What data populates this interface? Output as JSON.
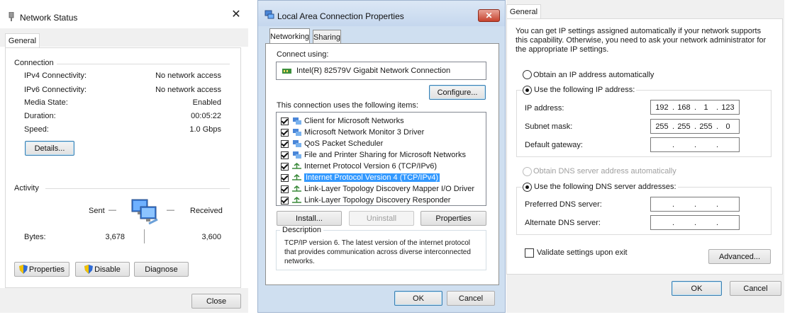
{
  "network_status": {
    "title": "Network Status",
    "close_glyph": "✕",
    "tab_general": "General",
    "connection_heading": "Connection",
    "rows": [
      {
        "label": "IPv4 Connectivity:",
        "value": "No network access"
      },
      {
        "label": "IPv6 Connectivity:",
        "value": "No network access"
      },
      {
        "label": "Media State:",
        "value": "Enabled"
      },
      {
        "label": "Duration:",
        "value": "00:05:22"
      },
      {
        "label": "Speed:",
        "value": "1.0 Gbps"
      }
    ],
    "details_button": "Details...",
    "activity_heading": "Activity",
    "sent_label": "Sent",
    "received_label": "Received",
    "dash": "—",
    "bytes_label": "Bytes:",
    "bytes_sent": "3,678",
    "bytes_received": "3,600",
    "properties_button": "Properties",
    "disable_button": "Disable",
    "diagnose_button": "Diagnose",
    "close_button": "Close"
  },
  "lan_properties": {
    "title": "Local Area Connection Properties",
    "close_glyph": "✕",
    "tabs": [
      "Networking",
      "Sharing"
    ],
    "connect_using_label": "Connect using:",
    "adapter_name": "Intel(R) 82579V Gigabit Network Connection",
    "configure_button": "Configure...",
    "items_label": "This connection uses the following items:",
    "items": [
      {
        "label": "Client for Microsoft Networks",
        "checked": true,
        "icon": "network-client-icon"
      },
      {
        "label": "Microsoft Network Monitor 3 Driver",
        "checked": true,
        "icon": "driver-icon"
      },
      {
        "label": "QoS Packet Scheduler",
        "checked": true,
        "icon": "scheduler-icon"
      },
      {
        "label": "File and Printer Sharing for Microsoft Networks",
        "checked": true,
        "icon": "sharing-icon"
      },
      {
        "label": "Internet Protocol Version 6 (TCP/IPv6)",
        "checked": true,
        "icon": "protocol-icon"
      },
      {
        "label": "Internet Protocol Version 4 (TCP/IPv4)",
        "checked": true,
        "icon": "protocol-icon",
        "selected": true
      },
      {
        "label": "Link-Layer Topology Discovery Mapper I/O Driver",
        "checked": true,
        "icon": "protocol-icon"
      },
      {
        "label": "Link-Layer Topology Discovery Responder",
        "checked": true,
        "icon": "protocol-icon"
      }
    ],
    "install_button": "Install...",
    "uninstall_button": "Uninstall",
    "properties_button": "Properties",
    "description_heading": "Description",
    "description_text": "TCP/IP version 6. The latest version of the internet protocol that provides communication across diverse interconnected networks.",
    "ok_button": "OK",
    "cancel_button": "Cancel"
  },
  "ipv4_properties": {
    "tab_general": "General",
    "intro_text": "You can get IP settings assigned automatically if your network supports this capability. Otherwise, you need to ask your network administrator for the appropriate IP settings.",
    "obtain_ip_auto": "Obtain an IP address automatically",
    "use_following_ip": "Use the following IP address:",
    "ip_address_label": "IP address:",
    "ip_address": [
      "192",
      "168",
      "1",
      "123"
    ],
    "subnet_mask_label": "Subnet mask:",
    "subnet_mask": [
      "255",
      "255",
      "255",
      "0"
    ],
    "default_gateway_label": "Default gateway:",
    "default_gateway": [
      "",
      "",
      "",
      ""
    ],
    "obtain_dns_auto": "Obtain DNS server address automatically",
    "use_following_dns": "Use the following DNS server addresses:",
    "preferred_dns_label": "Preferred DNS server:",
    "preferred_dns": [
      "",
      "",
      "",
      ""
    ],
    "alternate_dns_label": "Alternate DNS server:",
    "alternate_dns": [
      "",
      "",
      "",
      ""
    ],
    "validate_label": "Validate settings upon exit",
    "advanced_button": "Advanced...",
    "ok_button": "OK",
    "cancel_button": "Cancel",
    "dot": "."
  }
}
